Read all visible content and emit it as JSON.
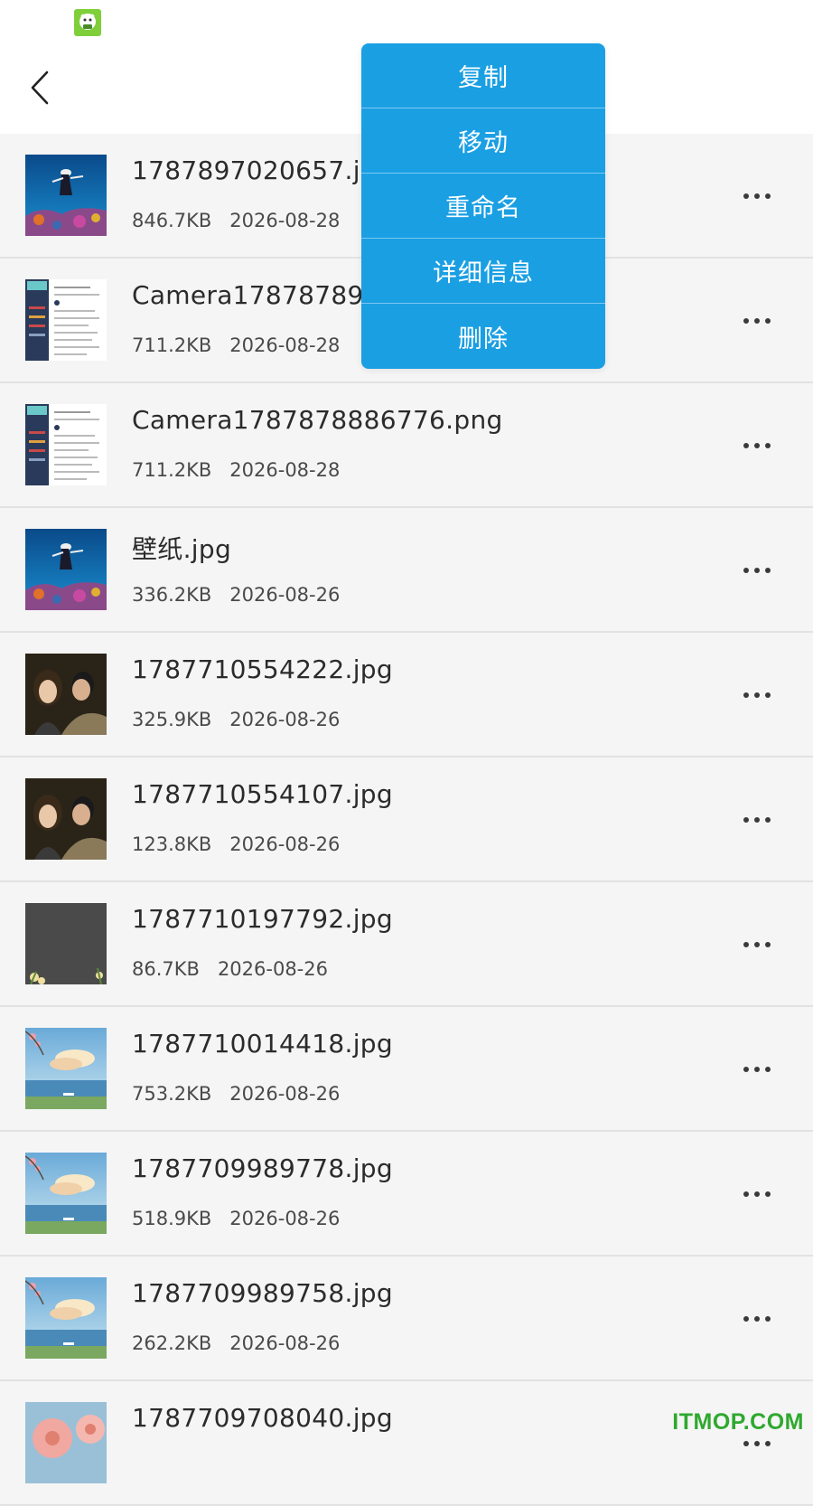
{
  "header": {
    "back_icon": "chevron-left-icon"
  },
  "status_bar": {
    "app_icon": "app-mascot-icon"
  },
  "popup_menu": {
    "items": [
      {
        "label": "复制"
      },
      {
        "label": "移动"
      },
      {
        "label": "重命名"
      },
      {
        "label": "详细信息"
      },
      {
        "label": "删除"
      }
    ]
  },
  "files": [
    {
      "name": "1787897020657.jpg",
      "size": "846.7KB",
      "date": "2026-08-28",
      "thumb": "diver-coral-reef"
    },
    {
      "name": "Camera1787878904",
      "size": "711.2KB",
      "date": "2026-08-28",
      "thumb": "app-screenshot"
    },
    {
      "name": "Camera1787878886776.png",
      "size": "711.2KB",
      "date": "2026-08-28",
      "thumb": "app-screenshot"
    },
    {
      "name": "壁纸.jpg",
      "size": "336.2KB",
      "date": "2026-08-26",
      "thumb": "diver-coral-reef"
    },
    {
      "name": "1787710554222.jpg",
      "size": "325.9KB",
      "date": "2026-08-26",
      "thumb": "couple-photo"
    },
    {
      "name": "1787710554107.jpg",
      "size": "123.8KB",
      "date": "2026-08-26",
      "thumb": "couple-photo"
    },
    {
      "name": "1787710197792.jpg",
      "size": "86.7KB",
      "date": "2026-08-26",
      "thumb": "dark-flowers"
    },
    {
      "name": "1787710014418.jpg",
      "size": "753.2KB",
      "date": "2026-08-26",
      "thumb": "beach-sky"
    },
    {
      "name": "1787709989778.jpg",
      "size": "518.9KB",
      "date": "2026-08-26",
      "thumb": "beach-sky"
    },
    {
      "name": "1787709989758.jpg",
      "size": "262.2KB",
      "date": "2026-08-26",
      "thumb": "beach-sky"
    },
    {
      "name": "1787709708040.jpg",
      "size": "",
      "date": "",
      "thumb": "pink-flowers"
    }
  ],
  "more_icon": "more-horizontal-icon",
  "watermark": "ITMOP.COM",
  "colors": {
    "accent": "#1a9fe3",
    "list_background": "#f5f5f5",
    "watermark": "#2fa82f"
  }
}
